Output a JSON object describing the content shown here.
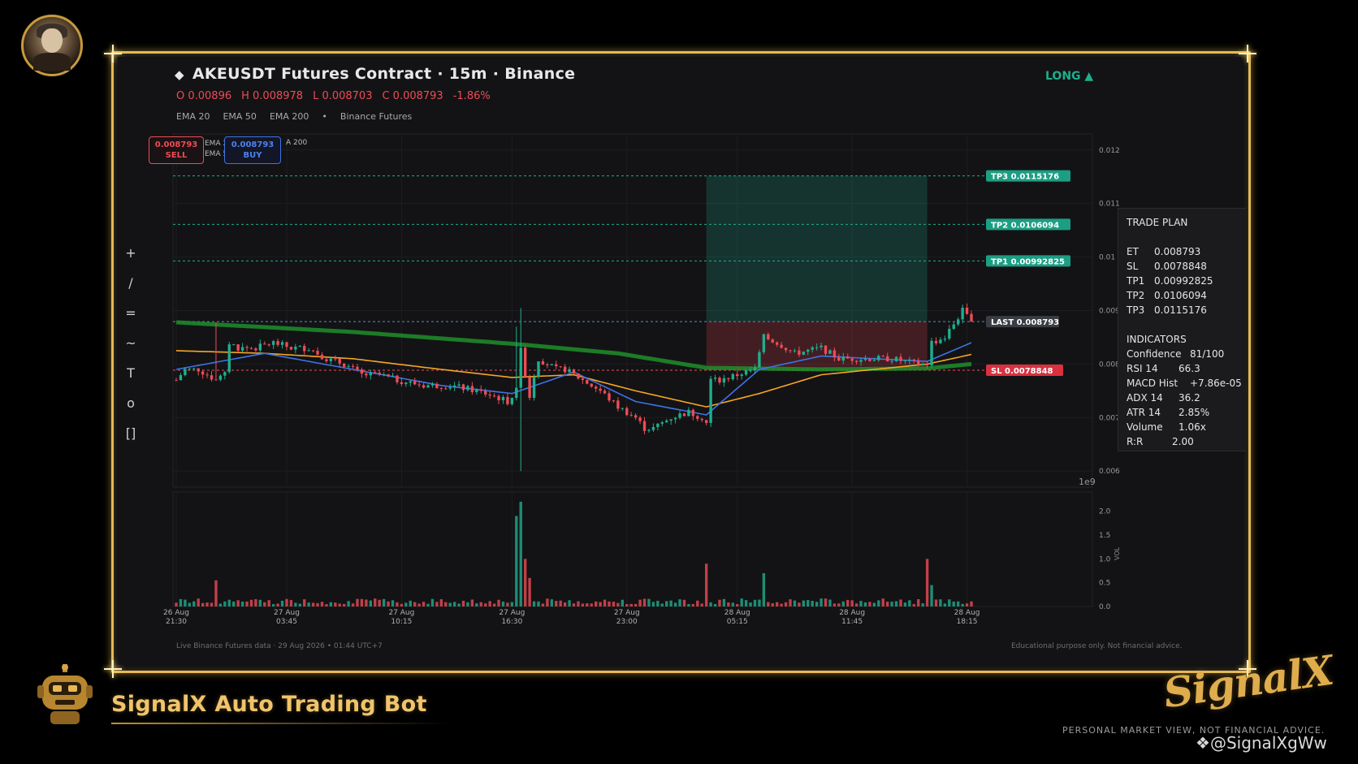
{
  "header": {
    "symbol_title": "AKEUSDT Futures Contract  ·  15m  ·  Binance",
    "direction": "LONG",
    "ohlc": {
      "open": "O 0.00896",
      "high": "H 0.008978",
      "low": "L 0.008703",
      "close": "C 0.008793",
      "change": "-1.86%"
    },
    "studies": [
      "EMA 20",
      "EMA 50",
      "EMA 200",
      "•",
      "Binance Futures"
    ]
  },
  "order_buttons": {
    "sell_price": "0.008793",
    "sell_label": "SELL",
    "buy_price": "0.008793",
    "buy_label": "BUY",
    "legend_fragments": [
      "EMA 2",
      "EMA 5",
      "A 200"
    ]
  },
  "toolbar": [
    "+",
    "/",
    "=",
    "~",
    "T",
    "o",
    "[]"
  ],
  "trade_plan": {
    "title": "TRADE PLAN",
    "levels": [
      {
        "label": "ET",
        "value": "0.008793"
      },
      {
        "label": "SL",
        "value": "0.0078848"
      },
      {
        "label": "TP1",
        "value": "0.00992825"
      },
      {
        "label": "TP2",
        "value": "0.0106094"
      },
      {
        "label": "TP3",
        "value": "0.0115176"
      }
    ],
    "indicators_title": "INDICATORS",
    "indicators": [
      {
        "label": "Confidence",
        "value": "81/100"
      },
      {
        "label": "RSI 14",
        "value": "66.3"
      },
      {
        "label": "MACD Hist",
        "value": "+7.86e-05"
      },
      {
        "label": "ADX 14",
        "value": "36.2"
      },
      {
        "label": "ATR 14",
        "value": "2.85%"
      },
      {
        "label": "Volume",
        "value": "1.06x"
      },
      {
        "label": "R:R",
        "value": "2.00"
      }
    ]
  },
  "footer": {
    "left": "Live Binance Futures data  ·  29 Aug 2026 • 01:44 UTC+7",
    "right": "Educational purpose only. Not financial advice."
  },
  "branding": {
    "bot_name": "SignalX Auto Trading Bot",
    "logo_text": "SignalX",
    "disclaimer": "PERSONAL MARKET VIEW, NOT FINANCIAL ADVICE.",
    "watermark": "@SignalXgWw"
  },
  "colors": {
    "up": "#1fae8d",
    "down": "#ef4b55",
    "ema20": "#3d74e8",
    "ema50": "#f5a623",
    "ema200": "#1f8f2a",
    "gold": "#e5b955"
  },
  "chart_data": {
    "type": "candlestick",
    "price_axis": {
      "ticks": [
        "0.012",
        "0.011",
        "0.01",
        "0.009",
        "0.008",
        "0.007",
        "0.006"
      ],
      "ylim": [
        0.0057,
        0.0123
      ],
      "scale_label": "1e9"
    },
    "volume_axis": {
      "ticks": [
        "2.0",
        "1.5",
        "1.0",
        "0.5",
        "0.0"
      ],
      "label": "VOL",
      "ylim": [
        0,
        2.2
      ]
    },
    "time_labels": [
      {
        "day": "26 Aug",
        "time": "21:30",
        "idx": 0
      },
      {
        "day": "27 Aug",
        "time": "03:45",
        "idx": 25
      },
      {
        "day": "27 Aug",
        "time": "10:15",
        "idx": 51
      },
      {
        "day": "27 Aug",
        "time": "16:30",
        "idx": 76
      },
      {
        "day": "27 Aug",
        "time": "23:00",
        "idx": 102
      },
      {
        "day": "28 Aug",
        "time": "05:15",
        "idx": 127
      },
      {
        "day": "28 Aug",
        "time": "11:45",
        "idx": 153
      },
      {
        "day": "28 Aug",
        "time": "18:15",
        "idx": 179
      }
    ],
    "levels": [
      {
        "name": "TP3",
        "value": 0.0115176,
        "label": "TP3  0.0115176",
        "color": "#1fae8d"
      },
      {
        "name": "TP2",
        "value": 0.0106094,
        "label": "TP2  0.0106094",
        "color": "#1fae8d"
      },
      {
        "name": "TP1",
        "value": 0.00992825,
        "label": "TP1  0.00992825",
        "color": "#1fae8d"
      },
      {
        "name": "LAST",
        "value": 0.008793,
        "label": "LAST  0.008793",
        "color": "#5b8fb9"
      },
      {
        "name": "SL",
        "value": 0.0078848,
        "label": "SL  0.0078848",
        "color": "#ef4b55"
      }
    ],
    "position_box": {
      "from_idx": 120,
      "to_idx": 170,
      "entry": 0.008793,
      "target": 0.0115176,
      "stop": 0.0078848
    },
    "close_waypoints": [
      [
        0,
        0.0077
      ],
      [
        2,
        0.0079
      ],
      [
        5,
        0.0079
      ],
      [
        9,
        0.0077
      ],
      [
        11,
        0.0078
      ],
      [
        12,
        0.0084
      ],
      [
        14,
        0.0083
      ],
      [
        18,
        0.0083
      ],
      [
        22,
        0.0084
      ],
      [
        26,
        0.0083
      ],
      [
        30,
        0.0083
      ],
      [
        34,
        0.0081
      ],
      [
        38,
        0.008
      ],
      [
        42,
        0.0078
      ],
      [
        46,
        0.0078
      ],
      [
        50,
        0.0077
      ],
      [
        56,
        0.0076
      ],
      [
        62,
        0.0076
      ],
      [
        68,
        0.0075
      ],
      [
        72,
        0.0074
      ],
      [
        75,
        0.0073
      ],
      [
        77,
        0.0075
      ],
      [
        78,
        0.0083
      ],
      [
        79,
        0.0078
      ],
      [
        80,
        0.0074
      ],
      [
        81,
        0.0078
      ],
      [
        82,
        0.0081
      ],
      [
        84,
        0.008
      ],
      [
        86,
        0.0079
      ],
      [
        88,
        0.0079
      ],
      [
        92,
        0.0077
      ],
      [
        96,
        0.0075
      ],
      [
        100,
        0.0072
      ],
      [
        104,
        0.007
      ],
      [
        106,
        0.0068
      ],
      [
        108,
        0.0068
      ],
      [
        112,
        0.007
      ],
      [
        116,
        0.0071
      ],
      [
        119,
        0.007
      ],
      [
        120,
        0.0069
      ],
      [
        121,
        0.0077
      ],
      [
        123,
        0.0077
      ],
      [
        127,
        0.0078
      ],
      [
        131,
        0.0079
      ],
      [
        133,
        0.0085
      ],
      [
        136,
        0.0084
      ],
      [
        140,
        0.0082
      ],
      [
        146,
        0.0083
      ],
      [
        150,
        0.0081
      ],
      [
        156,
        0.0081
      ],
      [
        162,
        0.0081
      ],
      [
        168,
        0.008
      ],
      [
        170,
        0.008
      ],
      [
        171,
        0.0084
      ],
      [
        174,
        0.0085
      ],
      [
        178,
        0.009
      ],
      [
        180,
        0.008793
      ]
    ],
    "ema20_waypoints": [
      [
        0,
        0.0079
      ],
      [
        20,
        0.0082
      ],
      [
        40,
        0.0079
      ],
      [
        60,
        0.0076
      ],
      [
        76,
        0.00745
      ],
      [
        90,
        0.00785
      ],
      [
        104,
        0.0073
      ],
      [
        120,
        0.00705
      ],
      [
        132,
        0.0079
      ],
      [
        146,
        0.00815
      ],
      [
        170,
        0.00805
      ],
      [
        180,
        0.0084
      ]
    ],
    "ema50_waypoints": [
      [
        0,
        0.00825
      ],
      [
        20,
        0.0082
      ],
      [
        40,
        0.0081
      ],
      [
        60,
        0.0079
      ],
      [
        76,
        0.00775
      ],
      [
        90,
        0.0078
      ],
      [
        104,
        0.0075
      ],
      [
        120,
        0.0072
      ],
      [
        132,
        0.00745
      ],
      [
        146,
        0.0078
      ],
      [
        170,
        0.008
      ],
      [
        180,
        0.00818
      ]
    ],
    "ema200_waypoints": [
      [
        0,
        0.00878
      ],
      [
        40,
        0.0086
      ],
      [
        76,
        0.00838
      ],
      [
        100,
        0.0082
      ],
      [
        120,
        0.00793
      ],
      [
        146,
        0.0079
      ],
      [
        170,
        0.00792
      ],
      [
        180,
        0.008
      ]
    ],
    "volume_spikes": [
      [
        9,
        0.55
      ],
      [
        77,
        1.9
      ],
      [
        78,
        2.2
      ],
      [
        79,
        1.0
      ],
      [
        80,
        0.6
      ],
      [
        120,
        0.9
      ],
      [
        133,
        0.7
      ],
      [
        170,
        1.0
      ],
      [
        171,
        0.45
      ]
    ],
    "candle_count": 181
  }
}
